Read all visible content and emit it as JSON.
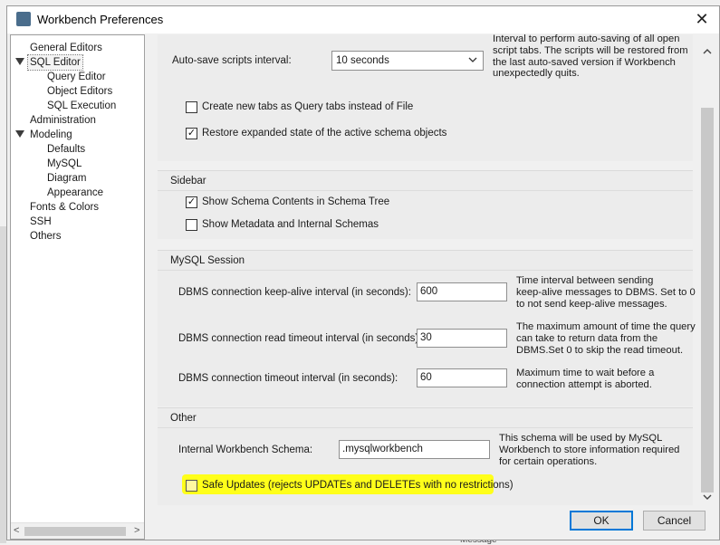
{
  "window": {
    "title": "Workbench Preferences",
    "close_glyph": "✕"
  },
  "tree": {
    "items": [
      {
        "label": "General Editors"
      },
      {
        "label": "SQL Editor"
      },
      {
        "label": "Query Editor"
      },
      {
        "label": "Object Editors"
      },
      {
        "label": "SQL Execution"
      },
      {
        "label": "Administration"
      },
      {
        "label": "Modeling"
      },
      {
        "label": "Defaults"
      },
      {
        "label": "MySQL"
      },
      {
        "label": "Diagram"
      },
      {
        "label": "Appearance"
      },
      {
        "label": "Fonts & Colors"
      },
      {
        "label": "SSH"
      },
      {
        "label": "Others"
      }
    ],
    "scroll_left": "<",
    "scroll_right": ">"
  },
  "general": {
    "autosave_label": "Auto-save scripts interval:",
    "autosave_value": "10 seconds",
    "autosave_desc_l0": "Interval to perform auto-saving of all open",
    "autosave_desc_l1": "script tabs. The scripts will be restored from",
    "autosave_desc_l2": "the last auto-saved version if Workbench",
    "autosave_desc_l3": "unexpectedly quits.",
    "new_tabs_label": "Create new tabs as Query tabs instead of File",
    "new_tabs_checked": false,
    "restore_label": "Restore expanded state of the active schema objects",
    "restore_checked": true
  },
  "sidebar": {
    "title": "Sidebar",
    "schema_contents_label": "Show Schema Contents in Schema Tree",
    "schema_contents_checked": true,
    "metadata_label": "Show Metadata and Internal Schemas",
    "metadata_checked": false
  },
  "session": {
    "title": "MySQL Session",
    "keepalive_label": "DBMS connection keep-alive interval (in seconds):",
    "keepalive_value": "600",
    "keepalive_desc_l0": "Time interval between sending",
    "keepalive_desc_l1": "keep-alive messages to DBMS. Set to 0",
    "keepalive_desc_l2": "to not send keep-alive messages.",
    "read_timeout_label": "DBMS connection read timeout interval (in seconds):",
    "read_timeout_value": "30",
    "read_timeout_desc_l0": "The maximum amount of time the query",
    "read_timeout_desc_l1": "can take to return data from the",
    "read_timeout_desc_l2": "DBMS.Set 0 to skip the read timeout.",
    "conn_timeout_label": "DBMS connection timeout interval (in seconds):",
    "conn_timeout_value": "60",
    "conn_timeout_desc_l0": "Maximum time to wait before a",
    "conn_timeout_desc_l1": "connection attempt is aborted."
  },
  "other": {
    "title": "Other",
    "schema_label": "Internal Workbench Schema:",
    "schema_value": ".mysqlworkbench",
    "schema_desc_l0": "This schema will be used by MySQL",
    "schema_desc_l1": "Workbench to store information required",
    "schema_desc_l2": "for certain operations.",
    "safe_updates_label": "Safe Updates (rejects UPDATEs and DELETEs with no restrictions)",
    "safe_updates_checked": false,
    "highlight_color": "#ffff1a"
  },
  "scrollbar": {
    "up": "^",
    "down": "v"
  },
  "buttons": {
    "ok": "OK",
    "cancel": "Cancel"
  },
  "background": {
    "partial_text": "Message"
  }
}
